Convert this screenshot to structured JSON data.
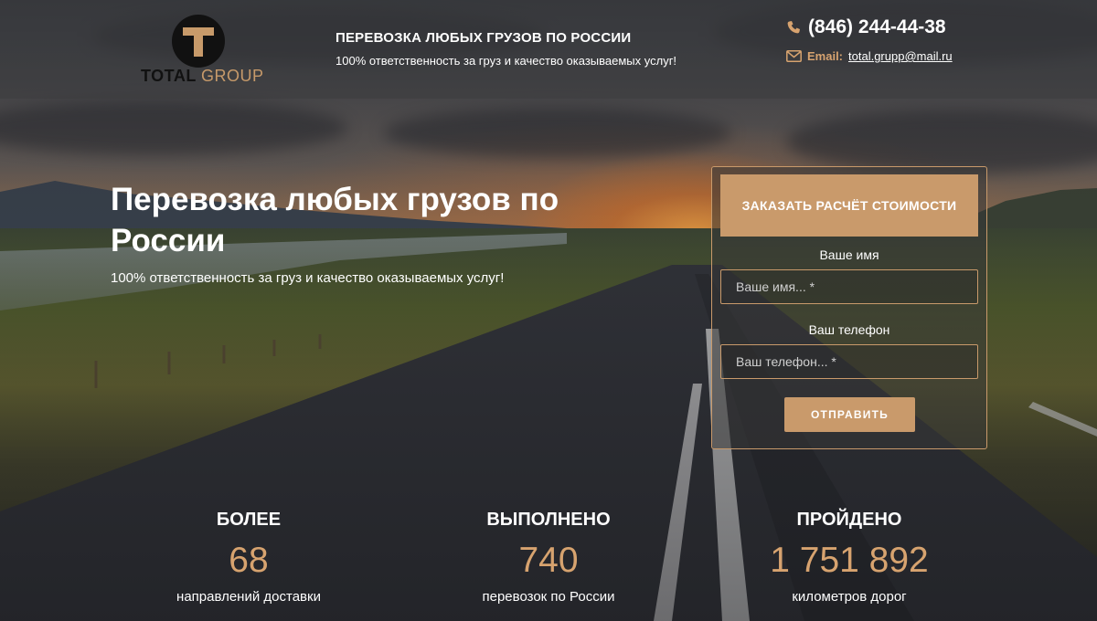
{
  "header": {
    "logo": {
      "word1": "TOTAL",
      "word2": "GROUP",
      "mark": "T"
    },
    "tagline_title": "ПЕРЕВОЗКА ЛЮБЫХ ГРУЗОВ ПО РОССИИ",
    "tagline_sub": "100% ответственность за груз и качество оказываемых услуг!",
    "phone": "(846) 244-44-38",
    "email_label": "Email:",
    "email": "total.grupp@mail.ru"
  },
  "hero": {
    "title": "Перевозка любых грузов по России",
    "subtitle": "100% ответственность за груз и качество оказываемых услуг!"
  },
  "form": {
    "heading": "ЗАКАЗАТЬ РАСЧЁТ СТОИМОСТИ",
    "name_label": "Ваше имя",
    "name_placeholder": "Ваше имя... *",
    "name_value": "",
    "phone_label": "Ваш телефон",
    "phone_placeholder": "Ваш телефон... *",
    "phone_value": "",
    "submit_label": "ОТПРАВИТЬ"
  },
  "stats": [
    {
      "heading": "БОЛЕЕ",
      "value": "68",
      "caption": "направлений доставки"
    },
    {
      "heading": "ВЫПОЛНЕНО",
      "value": "740",
      "caption": "перевозок по России"
    },
    {
      "heading": "ПРОЙДЕНО",
      "value": "1 751 892",
      "caption": "километров дорог"
    }
  ],
  "icons": {
    "phone": "phone-icon",
    "mail": "mail-icon"
  },
  "colors": {
    "accent": "#c99a6b",
    "accent_text": "#d7a36f"
  }
}
